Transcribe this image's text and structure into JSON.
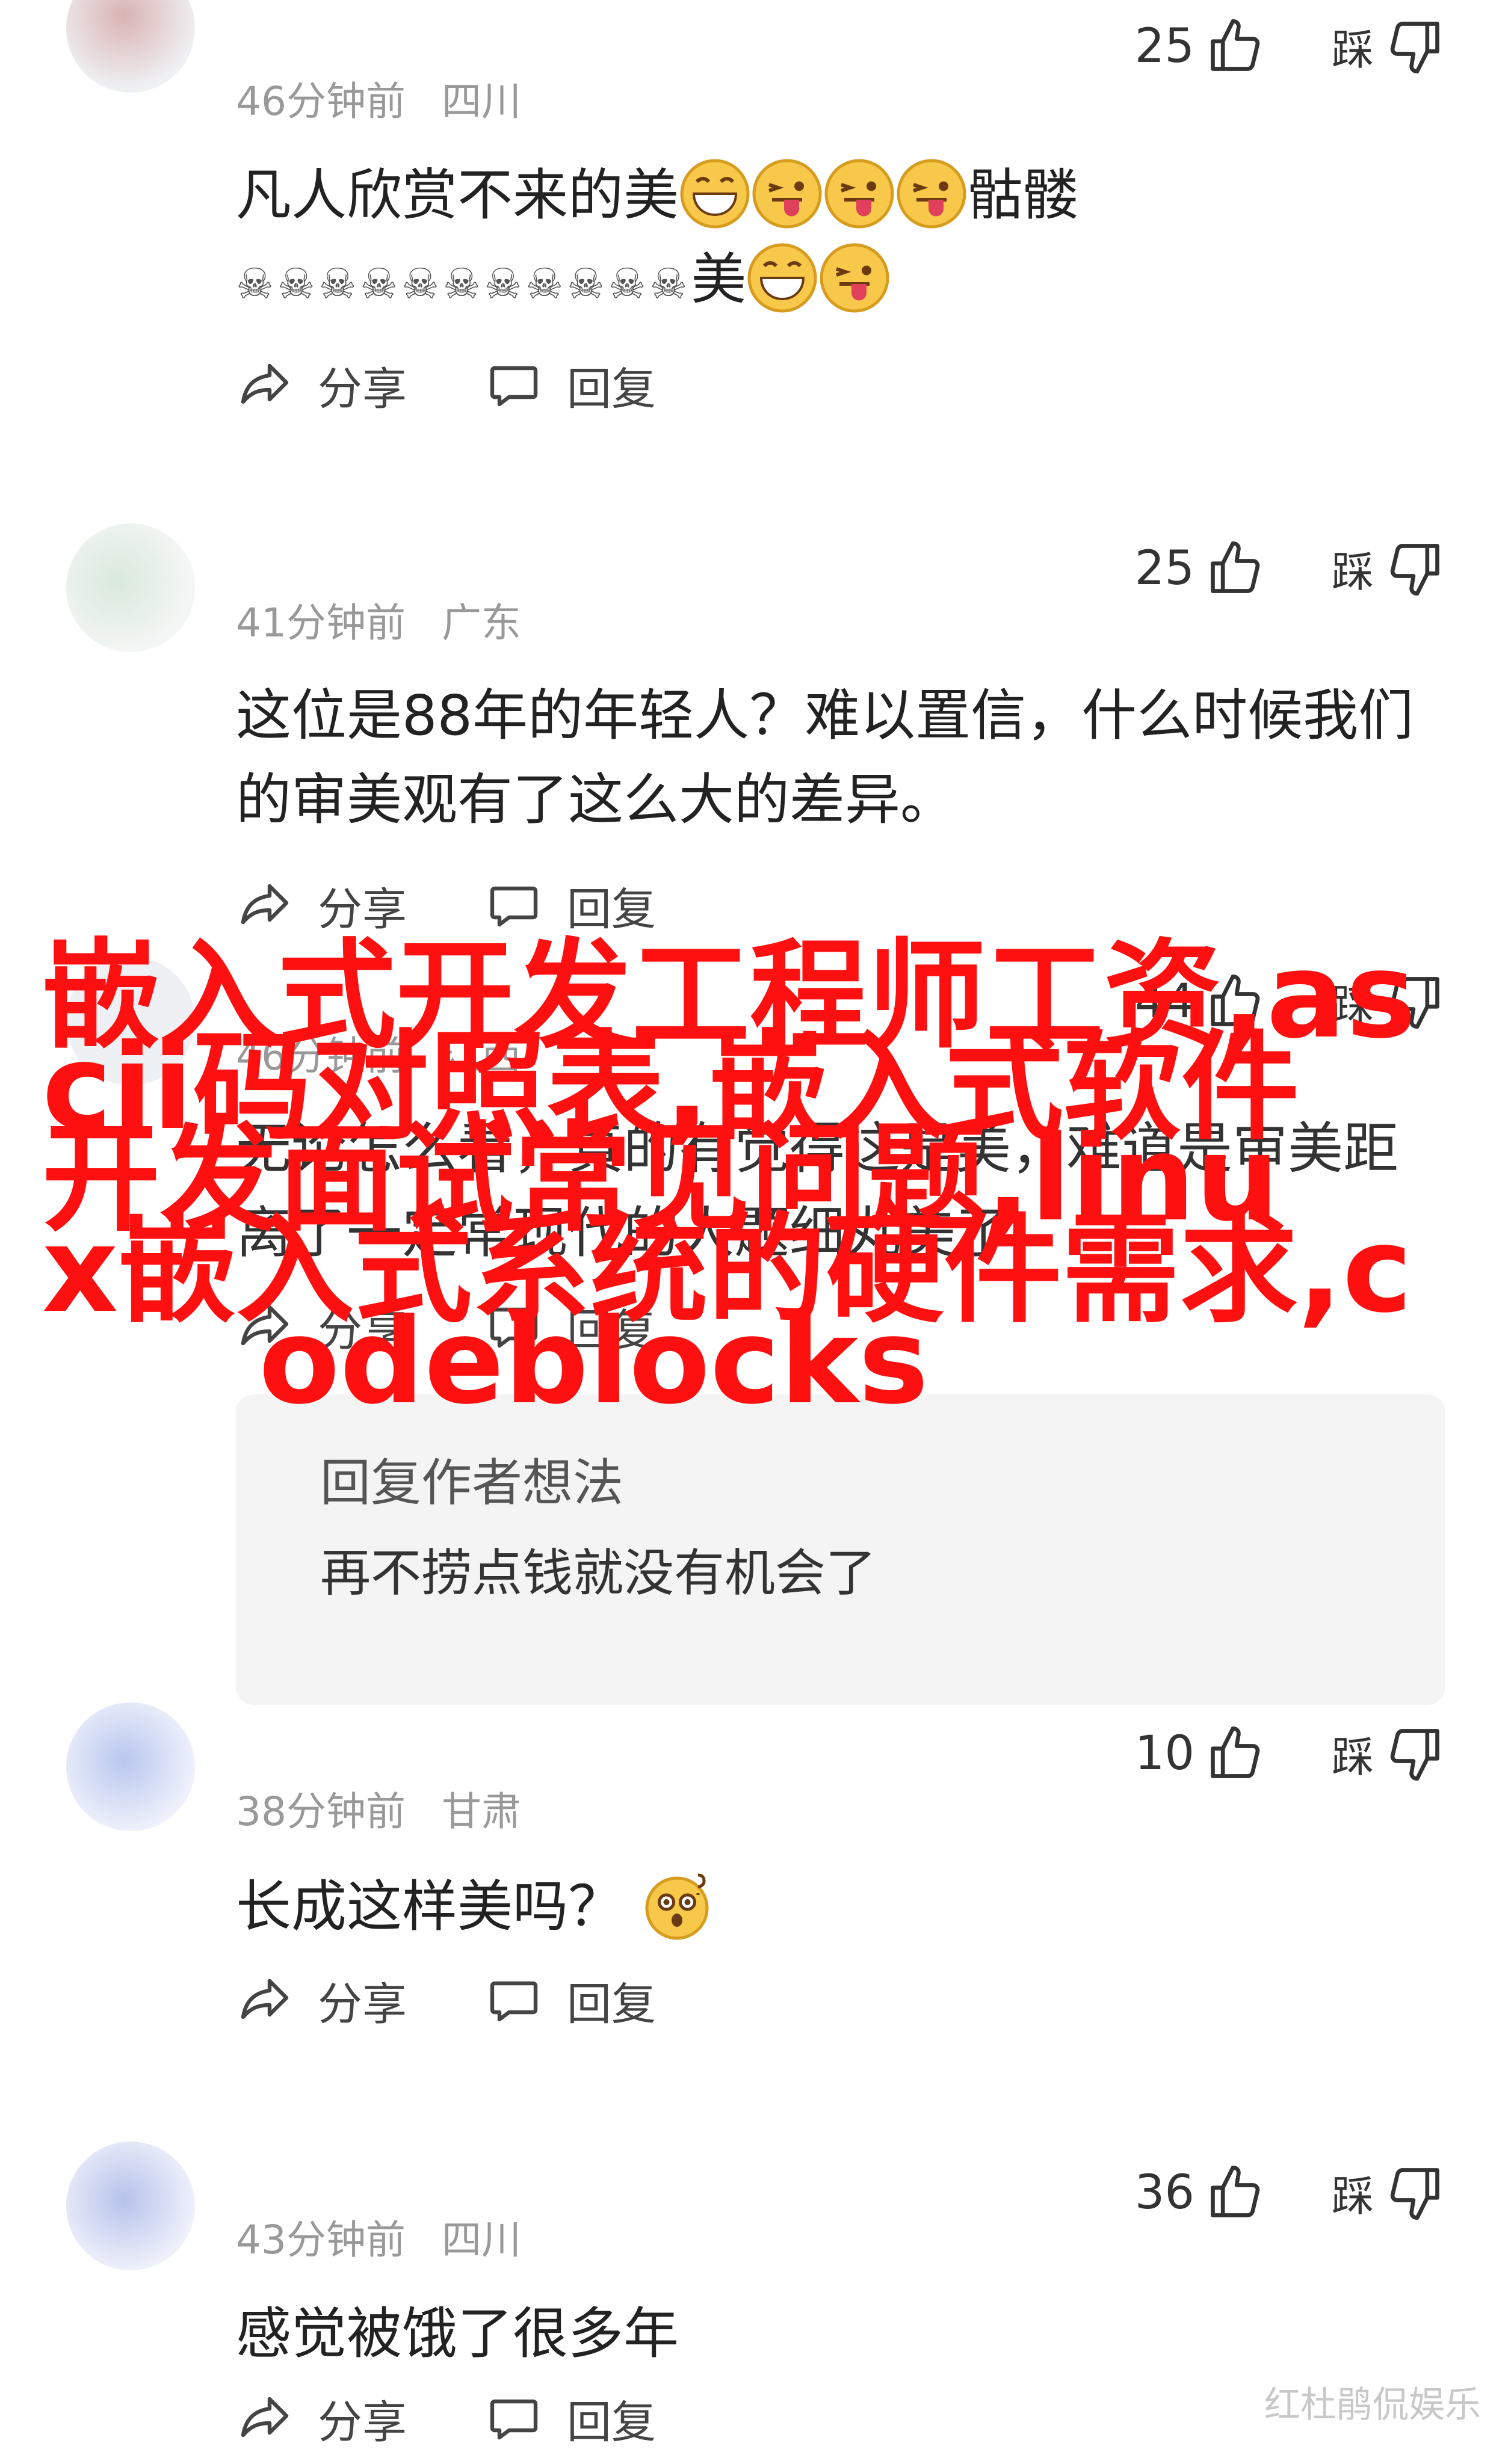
{
  "comments": [
    {
      "username": "",
      "time": "46分钟前",
      "region": "四川",
      "likes": "25",
      "dislike_label": "踩",
      "text_before": "凡人欣赏不来的美",
      "text_mid": "骷髅",
      "line2_skulls": "☠☠☠☠☠☠☠☠☠☠☠",
      "line2_tail": "美",
      "share_label": "分享",
      "reply_label": "回复"
    },
    {
      "username": "",
      "time": "41分钟前",
      "region": "广东",
      "likes": "25",
      "dislike_label": "踩",
      "text": "这位是88年的年轻人？难以置信，什么时候我们的审美观有了这么大的差异。",
      "share_label": "分享",
      "reply_label": "回复"
    },
    {
      "username": "",
      "time": "46分钟前",
      "region": "江西",
      "likes": "44",
      "dislike_label": "踩",
      "text": "无论怎么看，真的有觉得这是美，难道是审美距离了一定常现代的人题细丸美了",
      "share_label": "分享",
      "reply_label": "回复",
      "reply_preview": {
        "author": "",
        "title": "回复作者想法",
        "text": "再不捞点钱就没有机会了"
      }
    },
    {
      "username": "​",
      "time": "38分钟前",
      "region": "甘肃",
      "likes": "10",
      "dislike_label": "踩",
      "text": "长成这样美吗？",
      "share_label": "分享",
      "reply_label": "回复"
    },
    {
      "username": "",
      "time": "43分钟前",
      "region": "四川",
      "likes": "36",
      "dislike_label": "踩",
      "text": "感觉被饿了很多年",
      "share_label": "分享",
      "reply_label": "回复"
    }
  ],
  "overlay": {
    "lines": [
      "嵌入式开发工程师工资,as",
      "cii码对照表,嵌入式软件",
      "开发面试常见问题,linu",
      "x嵌入式系统的硬件需求,c",
      "  odeblocks"
    ],
    "color": "#ff1010"
  },
  "watermark": "红杜鹃侃娱乐",
  "icons": {
    "like": "thumbs-up-icon",
    "dislike": "thumbs-down-icon",
    "share": "share-arrow-icon",
    "reply": "chat-bubble-icon",
    "grin_emoji": "grinning-face-emoji",
    "tongue_emoji": "winking-tongue-emoji",
    "dizzy_emoji": "dizzy-face-emoji"
  }
}
